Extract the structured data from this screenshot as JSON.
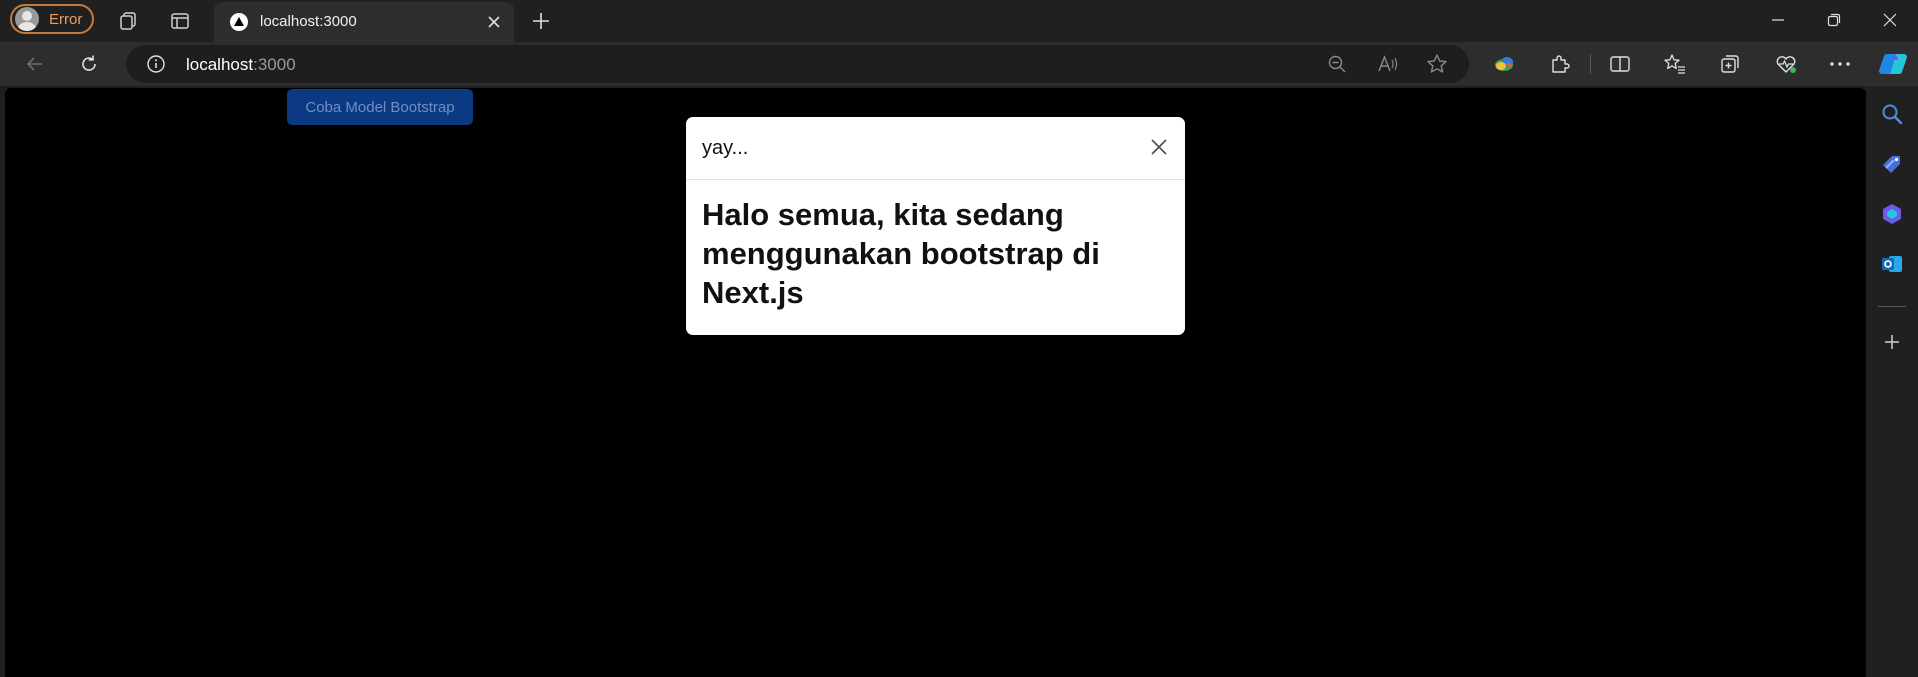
{
  "browser": {
    "profile_label": "Error",
    "tab": {
      "title": "localhost:3000"
    },
    "address": {
      "host": "localhost",
      "port": ":3000"
    },
    "icons": {
      "workspaces": "workspaces-icon",
      "tab_actions": "tab-actions-icon",
      "new_tab": "plus-icon",
      "back": "back-arrow-icon",
      "refresh": "refresh-icon",
      "info": "info-icon",
      "zoom": "zoom-out-icon",
      "read_aloud": "read-aloud-icon",
      "favorite": "star-icon",
      "extensions": "puzzle-icon",
      "split": "split-screen-icon",
      "favorites": "favorites-icon",
      "collections": "collections-icon",
      "health": "browser-essentials-icon",
      "more": "more-icon",
      "copilot": "copilot-icon"
    },
    "sidebar_icons": [
      "search-icon",
      "shopping-tag-icon",
      "copilot-app-icon",
      "outlook-icon",
      "add-icon"
    ]
  },
  "page": {
    "button_label": "Coba Model Bootstrap",
    "modal": {
      "title": "yay...",
      "body": "Halo semua, kita sedang menggunakan bootstrap di Next.js"
    }
  },
  "colors": {
    "profile_accent": "#c87a3a",
    "primary_button": "#0b3a82",
    "page_background": "#000000"
  }
}
